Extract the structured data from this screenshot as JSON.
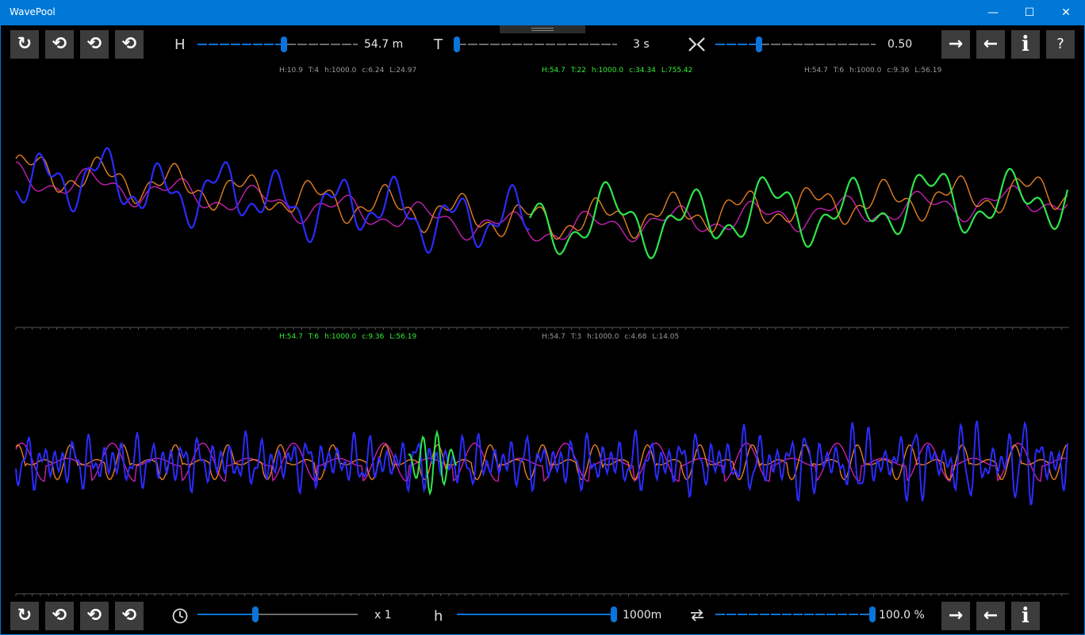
{
  "window": {
    "title": "WavePool",
    "minimize": "—",
    "maximize": "☐",
    "close": "✕"
  },
  "colors": {
    "titlebar": "#0078d7",
    "accent": "#0a74da",
    "button_bg": "#3c3c3c",
    "green": "#2ee64b",
    "blue": "#2b2bff",
    "orange": "#e67e22",
    "magenta": "#c71fb4"
  },
  "top_toolbar": {
    "buttons": [
      "reset-icon",
      "refresh-icon",
      "refresh-icon",
      "refresh-icon"
    ],
    "height": {
      "label": "H",
      "value": "54.7 m",
      "level": 0.54
    },
    "period": {
      "label": "T",
      "value": "3 s",
      "level": 0.0
    },
    "ratio": {
      "icon": "merge-arrows-icon",
      "value": "0.50",
      "level": 0.27
    },
    "right_buttons": {
      "next": "→",
      "prev": "←",
      "info": "i",
      "help": "?"
    }
  },
  "bottom_toolbar": {
    "buttons": [
      "reset-icon",
      "refresh-icon",
      "refresh-icon",
      "refresh-icon"
    ],
    "speed": {
      "icon": "clock-icon",
      "value": "x 1",
      "level": 0.36
    },
    "depth": {
      "label": "h",
      "value": "1000m",
      "level": 1.0
    },
    "loop": {
      "icon": "loop-icon",
      "value": "100.0 %",
      "level": 1.0
    },
    "right_buttons": {
      "next": "→",
      "prev": "←",
      "info": "i"
    }
  },
  "top_panel": {
    "infos": [
      {
        "H": "H:10.9",
        "T": "T:4",
        "h": "h:1000.0",
        "c": "c:6.24",
        "L": "L:24.97",
        "active": false
      },
      {
        "H": "H:54.7",
        "T": "T:22",
        "h": "h:1000.0",
        "c": "c:34.34",
        "L": "L:755.42",
        "active": true
      },
      {
        "H": "H:54.7",
        "T": "T:6",
        "h": "h:1000.0",
        "c": "c:9.36",
        "L": "L:56.19",
        "active": false
      }
    ]
  },
  "bottom_panel": {
    "infos": [
      {
        "H": "H:54.7",
        "T": "T:6",
        "h": "h:1000.0",
        "c": "c:9.36",
        "L": "L:56.19",
        "active": true
      },
      {
        "H": "H:54.7",
        "T": "T:3",
        "h": "h:1000.0",
        "c": "c:4.68",
        "L": "L:14.05",
        "active": false
      }
    ]
  }
}
